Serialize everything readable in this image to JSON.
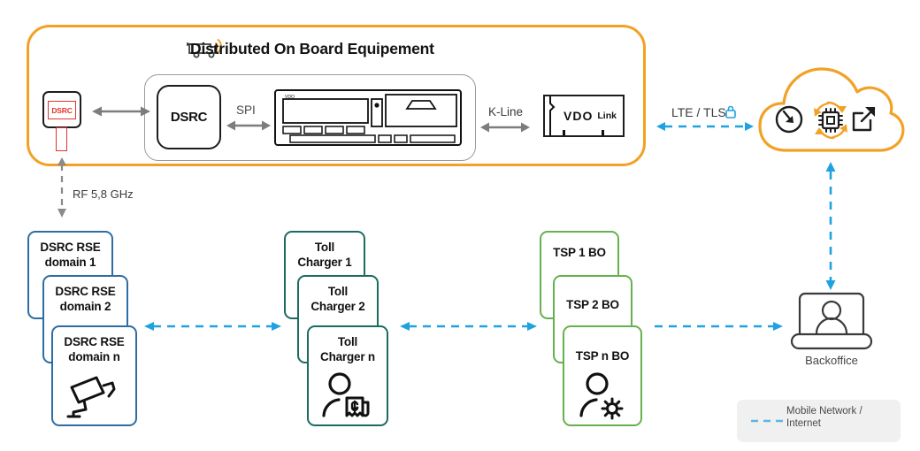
{
  "diagram": {
    "title": "Distributed On Board Equipement",
    "colors": {
      "orange": "#F2A125",
      "blue_dashed": "#1FA2E0",
      "rse_blue": "#2d6da4",
      "toll_teal": "#1c6b61",
      "tsp_green": "#66b14e",
      "red": "#e2342c",
      "gray_arrow": "#7d7d7d"
    }
  },
  "obe": {
    "title": "Distributed On Board Equipement",
    "truck_icon": "truck-signal-icon",
    "obu_tag": {
      "label": "DSRC"
    },
    "dsrc_module": {
      "label": "DSRC"
    },
    "tachograph": {
      "icon": "tachograph-icon",
      "brand": "VDO"
    },
    "vdo_link": {
      "brand": "VDO",
      "sub": "Link"
    }
  },
  "links": {
    "tag_to_dsrc": "",
    "spi": "SPI",
    "kline": "K-Line",
    "lte_tls": "LTE / TLS",
    "lte_tls_icon": "lock-icon",
    "rf": "RF 5,8 GHz"
  },
  "cloud": {
    "name": "cloud",
    "icons": [
      "clock-arrow-icon",
      "chip-refresh-icon",
      "external-link-icon"
    ]
  },
  "groups": [
    {
      "id": "dsrc-rse",
      "color": "blue",
      "cards": [
        "DSRC RSE\ndomain 1",
        "DSRC RSE\ndomain 2",
        "DSRC RSE\ndomain n"
      ],
      "icon": "roadside-camera-icon"
    },
    {
      "id": "toll-charger",
      "color": "teal",
      "cards": [
        "Toll\nCharger 1",
        "Toll\nCharger 2",
        "Toll\nCharger n"
      ],
      "icon": "person-invoice-icon"
    },
    {
      "id": "tsp-bo",
      "color": "green",
      "cards": [
        "TSP 1 BO",
        "TSP 2 BO",
        "TSP n BO"
      ],
      "icon": "person-gear-icon"
    }
  ],
  "cards": {
    "rse1_l1": "DSRC RSE",
    "rse1_l2": "domain 1",
    "rse2_l1": "DSRC RSE",
    "rse2_l2": "domain 2",
    "rsen_l1": "DSRC RSE",
    "rsen_l2": "domain n",
    "toll1_l1": "Toll",
    "toll1_l2": "Charger 1",
    "toll2_l1": "Toll",
    "toll2_l2": "Charger 2",
    "tolln_l1": "Toll",
    "tolln_l2": "Charger n",
    "tsp1": "TSP 1 BO",
    "tsp2": "TSP 2 BO",
    "tspn": "TSP n BO"
  },
  "backoffice": {
    "label": "Backoffice",
    "icon": "laptop-person-icon"
  },
  "legend": {
    "label_line1": "Mobile Network /",
    "label_line2": "Internet",
    "style": "blue-dashed"
  }
}
